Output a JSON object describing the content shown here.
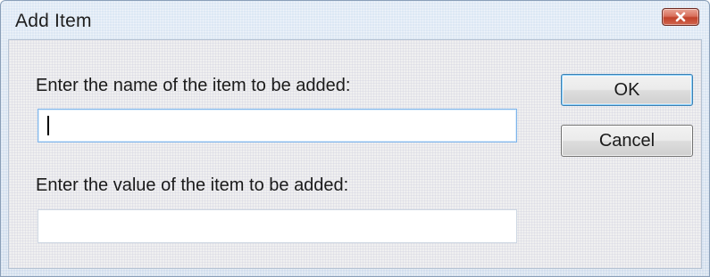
{
  "window": {
    "title": "Add Item"
  },
  "form": {
    "name_label": "Enter the name of the item to be added:",
    "name_value": "",
    "value_label": "Enter the value of the item to be added:",
    "value_value": ""
  },
  "buttons": {
    "ok_label": "OK",
    "cancel_label": "Cancel"
  },
  "icons": {
    "close": "close-icon"
  },
  "colors": {
    "close_button": "#c94a33",
    "focus_border": "#7eb4ea",
    "default_button_border": "#3c7fb1"
  }
}
